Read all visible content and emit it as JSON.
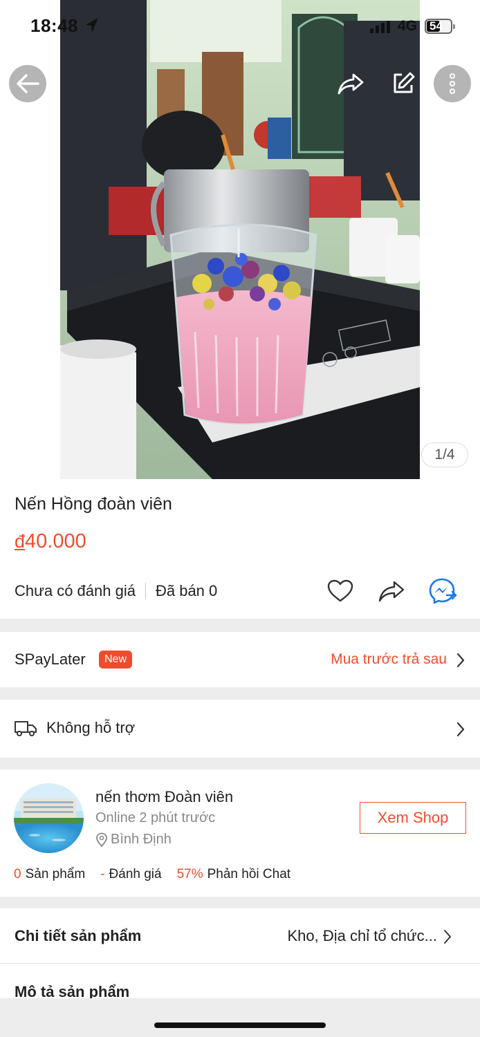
{
  "status_bar": {
    "time": "18:48",
    "network": "4G",
    "battery": "54",
    "battery_level": 0.54
  },
  "gallery": {
    "counter": "1/4"
  },
  "product": {
    "title": "Nến Hồng đoàn viên",
    "currency": "đ",
    "price": "40.000",
    "rating_text": "Chưa có đánh giá",
    "sold_text": "Đã bán 0"
  },
  "spaylater": {
    "label": "SPayLater",
    "badge": "New",
    "cta": "Mua trước trả sau"
  },
  "shipping": {
    "label": "Không hỗ trợ"
  },
  "shop": {
    "name": "nến thơm Đoàn viên",
    "online": "Online 2 phút trước",
    "location": "Bình Định",
    "view_button": "Xem Shop",
    "products_count": "0",
    "products_label": "Sản phẩm",
    "rating_value": "-",
    "rating_label": "Đánh giá",
    "chat_rate": "57%",
    "chat_label": "Phản hồi Chat"
  },
  "details": {
    "label": "Chi tiết sản phẩm",
    "value": "Kho, Địa chỉ tổ chức..."
  },
  "description": {
    "label": "Mô tả sản phẩm"
  },
  "icons": {
    "back": "back-arrow-icon",
    "share": "share-icon",
    "edit": "edit-icon",
    "more": "more-vertical-icon",
    "like": "heart-icon",
    "share2": "share-icon",
    "messenger": "messenger-icon",
    "truck": "truck-icon",
    "pin": "location-pin-icon",
    "chevron": "chevron-right-icon"
  },
  "colors": {
    "accent": "#ee4d2d",
    "messenger": "#1877f2"
  }
}
